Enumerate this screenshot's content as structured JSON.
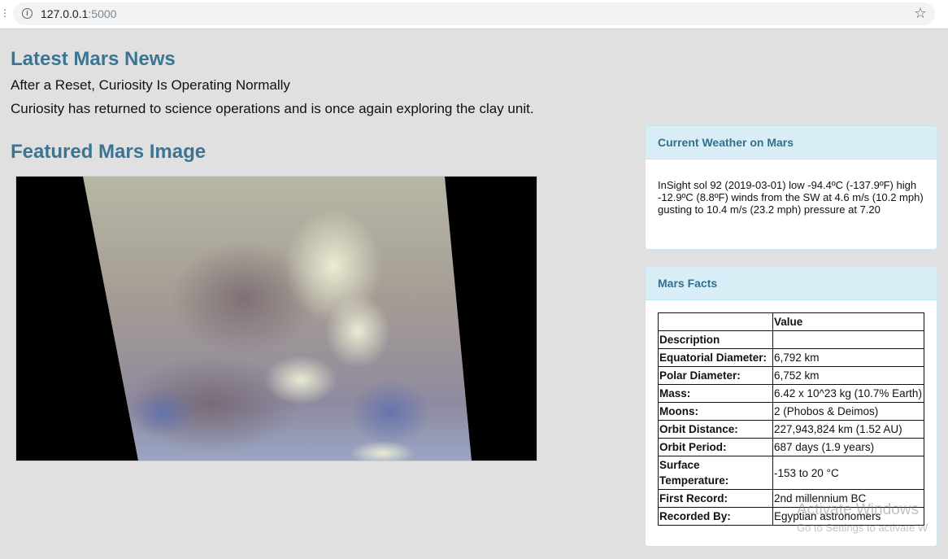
{
  "browser": {
    "url_host": "127.0.0.1",
    "url_port": ":5000"
  },
  "news": {
    "heading": "Latest Mars News",
    "title": "After a Reset, Curiosity Is Operating Normally",
    "teaser": "Curiosity has returned to science operations and is once again exploring the clay unit."
  },
  "featured": {
    "heading": "Featured Mars Image"
  },
  "weather": {
    "heading": "Current Weather on Mars",
    "text": "InSight sol 92 (2019-03-01) low -94.4ºC (-137.9ºF) high -12.9ºC (8.8ºF) winds from the SW at 4.6 m/s (10.2 mph) gusting to 10.4 m/s (23.2 mph) pressure at 7.20"
  },
  "facts": {
    "heading": "Mars Facts",
    "column_header": "Value",
    "rows": [
      {
        "label": "Description",
        "value": ""
      },
      {
        "label": "Equatorial Diameter:",
        "value": "6,792 km"
      },
      {
        "label": "Polar Diameter:",
        "value": "6,752 km"
      },
      {
        "label": "Mass:",
        "value": "6.42 x 10^23 kg (10.7% Earth)"
      },
      {
        "label": "Moons:",
        "value": "2 (Phobos & Deimos)"
      },
      {
        "label": "Orbit Distance:",
        "value": "227,943,824 km (1.52 AU)"
      },
      {
        "label": "Orbit Period:",
        "value": "687 days (1.9 years)"
      },
      {
        "label": "Surface Temperature:",
        "value": "-153 to 20 °C"
      },
      {
        "label": "First Record:",
        "value": "2nd millennium BC"
      },
      {
        "label": "Recorded By:",
        "value": "Egyptian astronomers"
      }
    ]
  },
  "watermark": {
    "title": "Activate Windows",
    "subtitle": "Go to Settings to activate W"
  }
}
